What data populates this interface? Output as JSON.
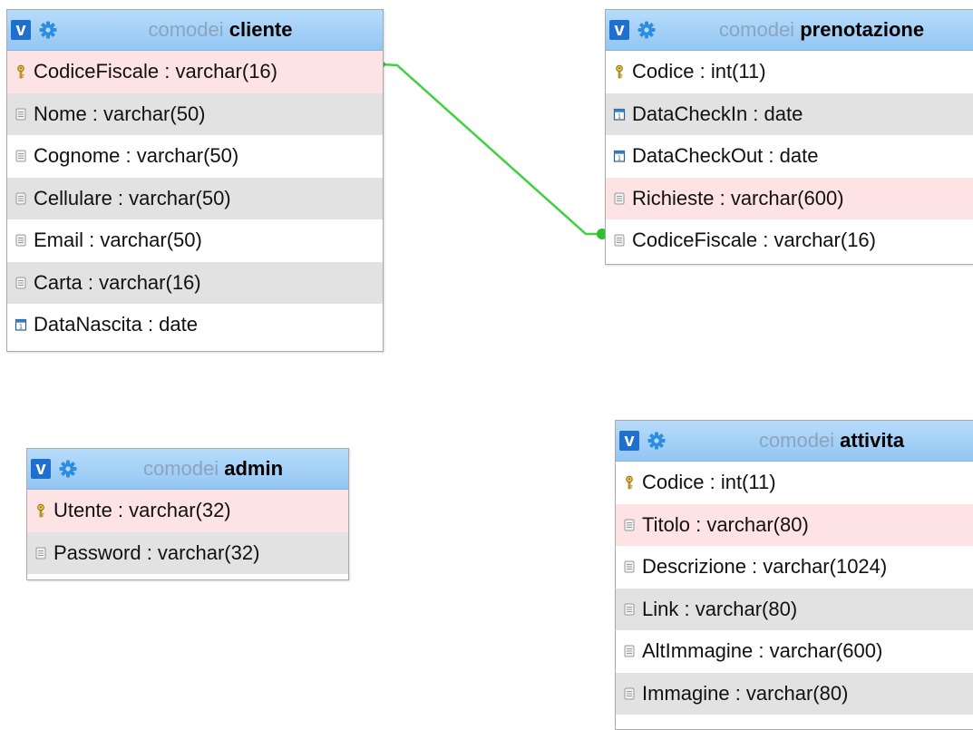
{
  "database": "comodei",
  "tables": {
    "cliente": {
      "db": "comodei",
      "name": "cliente",
      "columns": [
        {
          "label": "CodiceFiscale : varchar(16)",
          "icon": "key-icon",
          "highlight": true
        },
        {
          "label": "Nome : varchar(50)",
          "icon": "column-icon"
        },
        {
          "label": "Cognome : varchar(50)",
          "icon": "column-icon"
        },
        {
          "label": "Cellulare : varchar(50)",
          "icon": "column-icon"
        },
        {
          "label": "Email : varchar(50)",
          "icon": "column-icon"
        },
        {
          "label": "Carta : varchar(16)",
          "icon": "column-icon"
        },
        {
          "label": "DataNascita : date",
          "icon": "date-icon"
        }
      ]
    },
    "prenotazione": {
      "db": "comodei",
      "name": "prenotazione",
      "columns": [
        {
          "label": "Codice : int(11)",
          "icon": "key-icon"
        },
        {
          "label": "DataCheckIn : date",
          "icon": "date-icon"
        },
        {
          "label": "DataCheckOut : date",
          "icon": "date-icon"
        },
        {
          "label": "Richieste : varchar(600)",
          "icon": "column-icon",
          "highlight": true
        },
        {
          "label": "CodiceFiscale : varchar(16)",
          "icon": "column-icon"
        }
      ]
    },
    "admin": {
      "db": "comodei",
      "name": "admin",
      "columns": [
        {
          "label": "Utente : varchar(32)",
          "icon": "key-icon",
          "highlight": true
        },
        {
          "label": "Password : varchar(32)",
          "icon": "column-icon"
        }
      ]
    },
    "attivita": {
      "db": "comodei",
      "name": "attivita",
      "columns": [
        {
          "label": "Codice : int(11)",
          "icon": "key-icon"
        },
        {
          "label": "Titolo : varchar(80)",
          "icon": "column-icon",
          "highlight": true
        },
        {
          "label": "Descrizione : varchar(1024)",
          "icon": "column-icon"
        },
        {
          "label": "Link : varchar(80)",
          "icon": "column-icon"
        },
        {
          "label": "AltImmagine : varchar(600)",
          "icon": "column-icon"
        },
        {
          "label": "Immagine : varchar(80)",
          "icon": "column-icon"
        }
      ]
    }
  },
  "relations": [
    {
      "from": "prenotazione.CodiceFiscale",
      "to": "cliente.CodiceFiscale",
      "color": "#3fd23f"
    }
  ],
  "colors": {
    "header_start": "#b7dcfb",
    "header_end": "#93c6f3",
    "v_badge": "#1f6fd0",
    "gear": "#2e8de0",
    "db_name": "#8ca4bc",
    "row_alt": "#e2e2e2",
    "row_highlight": "#fde3e3",
    "relation": "#3fd23f"
  }
}
